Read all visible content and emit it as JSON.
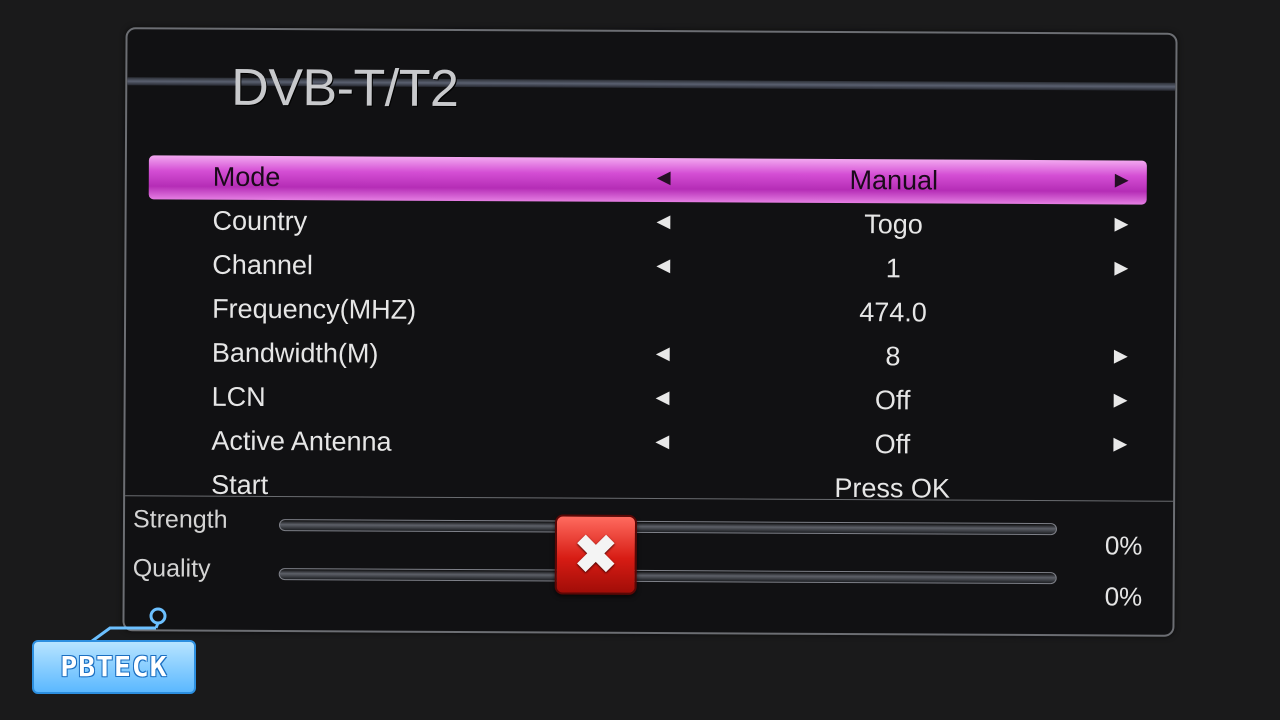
{
  "title": "DVB-T/T2",
  "menu": [
    {
      "label": "Mode",
      "value": "Manual",
      "has_arrows": true,
      "selected": true
    },
    {
      "label": "Country",
      "value": "Togo",
      "has_arrows": true,
      "selected": false
    },
    {
      "label": "Channel",
      "value": "1",
      "has_arrows": true,
      "selected": false
    },
    {
      "label": "Frequency(MHZ)",
      "value": "474.0",
      "has_arrows": false,
      "selected": false
    },
    {
      "label": "Bandwidth(M)",
      "value": "8",
      "has_arrows": true,
      "selected": false
    },
    {
      "label": "LCN",
      "value": "Off",
      "has_arrows": true,
      "selected": false
    },
    {
      "label": "Active Antenna",
      "value": "Off",
      "has_arrows": true,
      "selected": false
    },
    {
      "label": "Start",
      "value": "Press OK",
      "has_arrows": false,
      "selected": false
    }
  ],
  "arrows": {
    "left": "◀",
    "right": "▶"
  },
  "signal": {
    "strength": {
      "label": "Strength",
      "value_text": "0%",
      "level": 0
    },
    "quality": {
      "label": "Quality",
      "value_text": "0%",
      "level": 0
    }
  },
  "overlay": {
    "icon": "error-x-icon",
    "glyph": "✖"
  },
  "watermark": {
    "text": "PBTECK"
  },
  "colors": {
    "highlight": "#c83fc9",
    "background": "#111113"
  }
}
